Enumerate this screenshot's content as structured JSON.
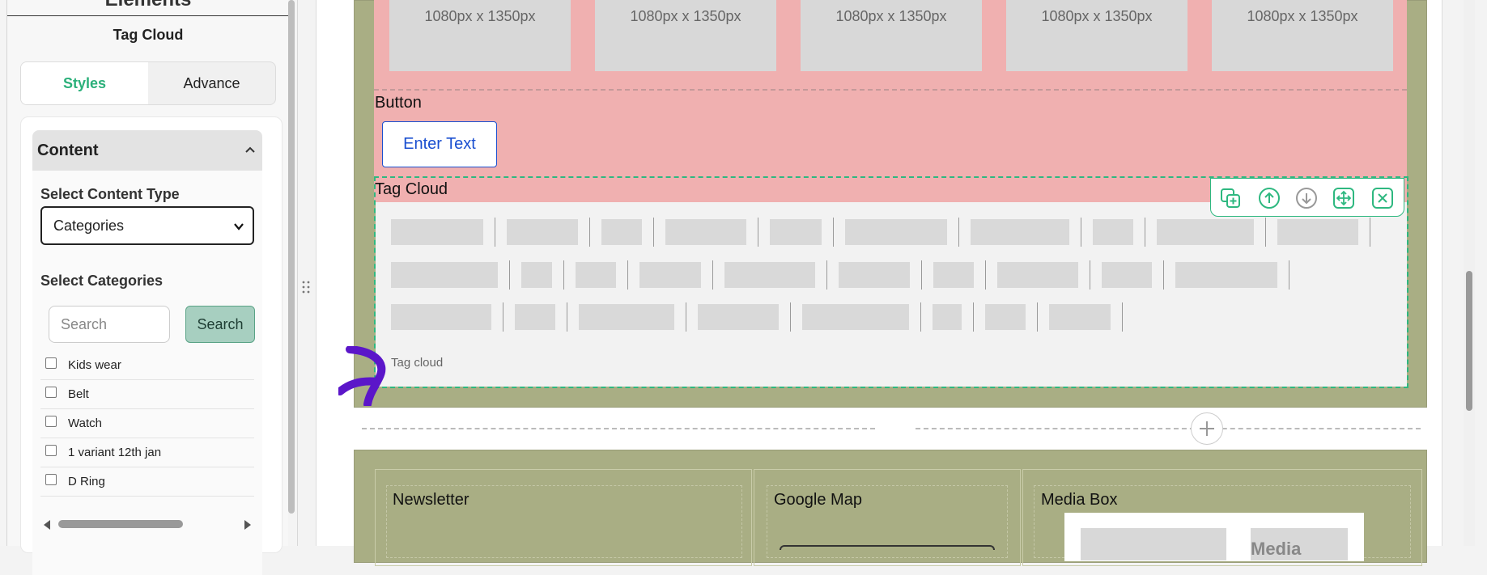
{
  "left_panel": {
    "elements_title": "Elements",
    "heading": "Tag Cloud",
    "tabs": [
      {
        "label": "Styles",
        "active": true
      },
      {
        "label": "Advance",
        "active": false
      }
    ],
    "accordion": {
      "title": "Content",
      "select_content_type_label": "Select Content Type",
      "select_content_type_value": "Categories",
      "select_categories_label": "Select Categories",
      "search_placeholder": "Search",
      "search_button": "Search",
      "categories": [
        {
          "label": "Kids wear",
          "checked": false
        },
        {
          "label": "Belt",
          "checked": false
        },
        {
          "label": "Watch",
          "checked": false
        },
        {
          "label": "1 variant 12th jan",
          "checked": false
        },
        {
          "label": "D Ring",
          "checked": false
        }
      ]
    }
  },
  "canvas": {
    "image_placeholders": [
      "1080px x 1350px",
      "1080px x 1350px",
      "1080px x 1350px",
      "1080px x 1350px",
      "1080px x 1350px"
    ],
    "button_section_label": "Button",
    "button_text": "Enter Text",
    "tag_cloud_heading": "Tag Cloud",
    "tag_cloud_caption": "Tag cloud",
    "bottom_columns": [
      "Newsletter",
      "Google Map",
      "Media Box"
    ],
    "media_box_text": "Media"
  },
  "colors": {
    "accent_green": "#2bb07a",
    "section_olive": "#a9ae84",
    "pink_zone": "#f0b0b0",
    "button_blue": "#1a4fd0",
    "purple_cursor": "#5b16c9"
  },
  "icons": {
    "toolbar": [
      "duplicate-icon",
      "move-up-icon",
      "move-down-icon",
      "drag-move-icon",
      "delete-icon"
    ],
    "add": "plus-icon"
  }
}
